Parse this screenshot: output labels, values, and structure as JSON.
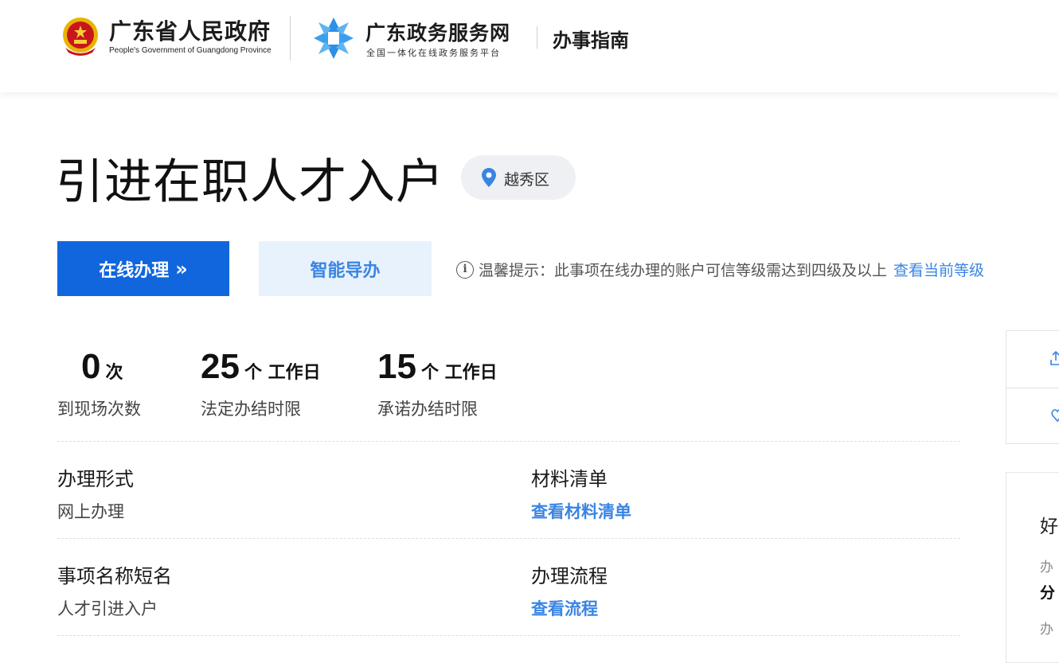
{
  "header": {
    "gov_name": "广东省人民政府",
    "gov_name_en": "People's Government of Guangdong Province",
    "service_name": "广东政务服务网",
    "service_subtitle": "全国一体化在线政务服务平台",
    "section_title": "办事指南"
  },
  "item": {
    "title": "引进在职人才入户",
    "region": "越秀区"
  },
  "actions": {
    "online_label": "在线办理",
    "online_chevron": "»",
    "smart_label": "智能导办",
    "tip_icon": "i",
    "tip_text": "温馨提示：此事项在线办理的账户可信等级需达到四级及以上",
    "tip_link": "查看当前等级"
  },
  "stats": [
    {
      "value": "0",
      "unit": "次",
      "label": "到现场次数"
    },
    {
      "value": "25",
      "unit": "个 工作日",
      "label": "法定办结时限"
    },
    {
      "value": "15",
      "unit": "个 工作日",
      "label": "承诺办结时限"
    }
  ],
  "fields": {
    "form": {
      "name": "办理形式",
      "value": "网上办理"
    },
    "materials": {
      "name": "材料清单",
      "link": "查看材料清单"
    },
    "short_name": {
      "name": "事项名称短名",
      "value": "人才引进入户"
    },
    "process": {
      "name": "办理流程",
      "link": "查看流程"
    }
  },
  "side_card": {
    "line1": "好",
    "line2": "办",
    "line3": "分",
    "line4": "办"
  },
  "colors": {
    "primary": "#1166dd",
    "link": "#3a84e4",
    "secondary_bg": "#e8f2fd",
    "emblem_red": "#c8161d",
    "emblem_gold": "#e8b400"
  },
  "icons": [
    "national-emblem-icon",
    "service-logo-icon",
    "location-pin-icon",
    "info-icon",
    "share-icon",
    "favorite-icon"
  ]
}
